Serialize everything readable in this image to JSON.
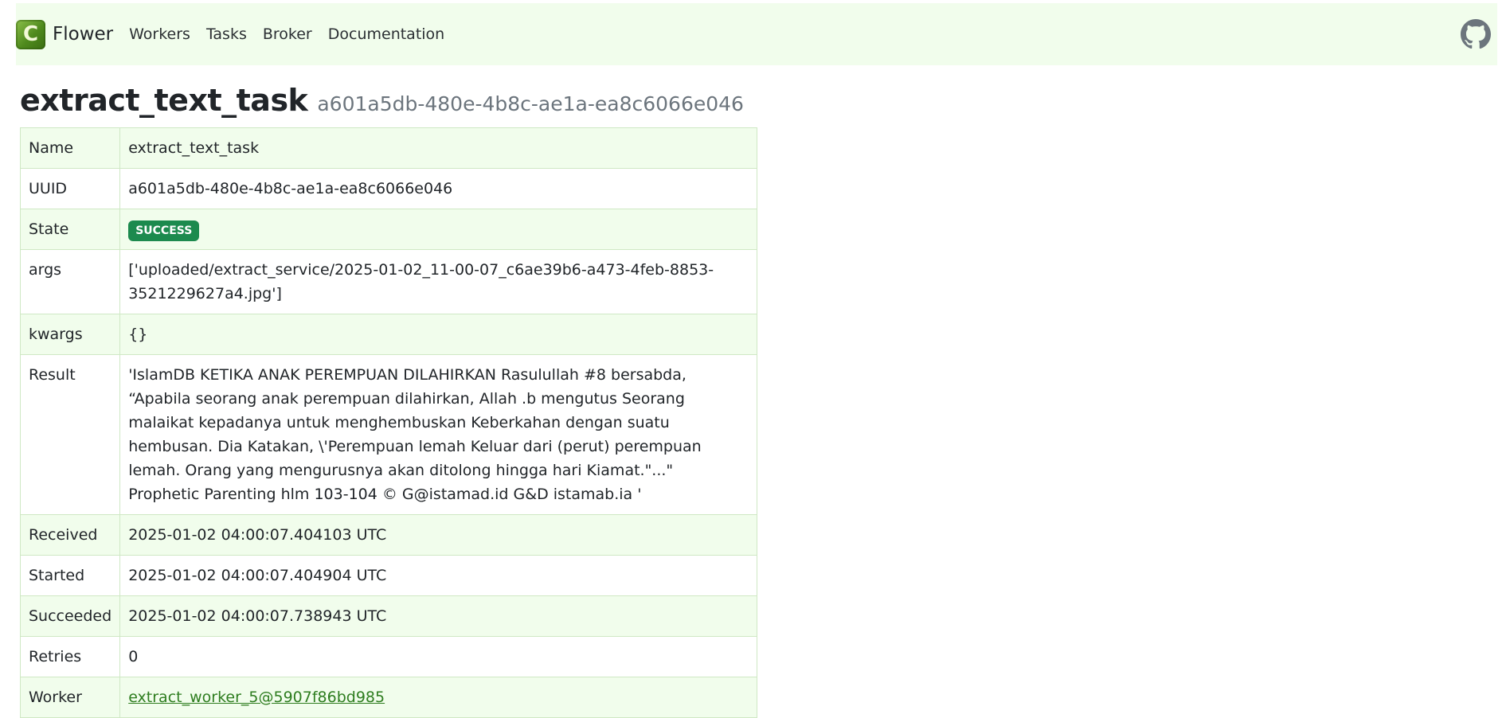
{
  "navbar": {
    "brand": "Flower",
    "brand_letter": "C",
    "links": [
      "Workers",
      "Tasks",
      "Broker",
      "Documentation"
    ],
    "github_icon": "github-icon"
  },
  "heading": {
    "task_name": "extract_text_task",
    "task_uuid": "a601a5db-480e-4b8c-ae1a-ea8c6066e046"
  },
  "colors": {
    "navbar_bg": "#f1fdec",
    "row_alt_bg": "#f1fdec",
    "success_badge": "#1c8a4e",
    "link": "#2e7d1f"
  },
  "details": {
    "rows": [
      {
        "label": "Name",
        "value": "extract_text_task"
      },
      {
        "label": "UUID",
        "value": "a601a5db-480e-4b8c-ae1a-ea8c6066e046"
      },
      {
        "label": "State",
        "value": "SUCCESS"
      },
      {
        "label": "args",
        "value": "['uploaded/extract_service/2025-01-02_11-00-07_c6ae39b6-a473-4feb-8853-3521229627a4.jpg']"
      },
      {
        "label": "kwargs",
        "value": "{}"
      },
      {
        "label": "Result",
        "value": "'IslamDB KETIKA ANAK PEREMPUAN DILAHIRKAN Rasulullah #8 bersabda, “Apabila seorang anak perempuan dilahirkan, Allah .b mengutus Seorang malaikat kepadanya untuk menghembuskan Keberkahan dengan suatu hembusan. Dia Katakan, \\'Perempuan lemah Keluar dari (perut) perempuan lemah. Orang yang mengurusnya akan ditolong hingga hari Kiamat.\"...\" Prophetic Parenting hlm 103-104 © G@istamad.id G&D istamab.ia '"
      },
      {
        "label": "Received",
        "value": "2025-01-02 04:00:07.404103 UTC"
      },
      {
        "label": "Started",
        "value": "2025-01-02 04:00:07.404904 UTC"
      },
      {
        "label": "Succeeded",
        "value": "2025-01-02 04:00:07.738943 UTC"
      },
      {
        "label": "Retries",
        "value": "0"
      },
      {
        "label": "Worker",
        "value": "extract_worker_5@5907f86bd985"
      }
    ]
  }
}
